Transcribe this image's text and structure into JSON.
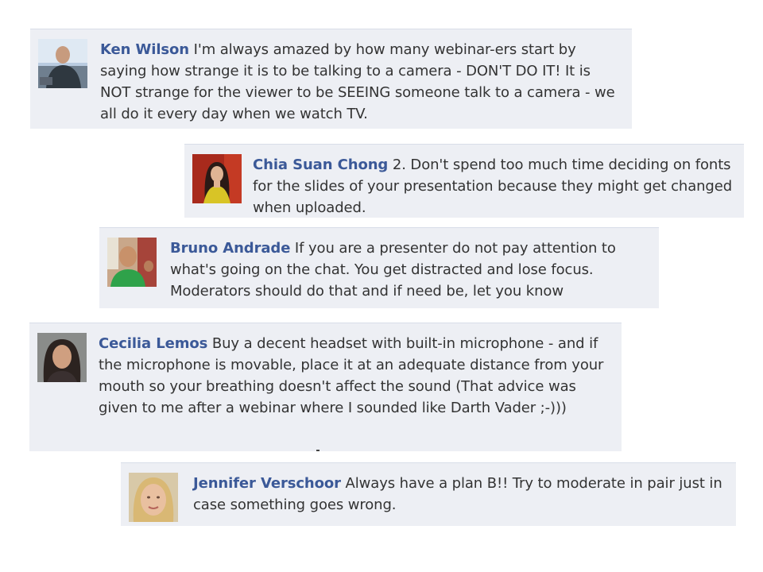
{
  "comments": [
    {
      "author": "Ken Wilson",
      "text": " I'm always amazed by how many webinar-ers start by saying how strange it is to be talking to a camera - DON'T DO IT! It is NOT strange for the viewer to be SEEING someone talk to a camera - we all do it every day when we watch TV."
    },
    {
      "author": "Chia Suan Chong",
      "text": " 2. Don't spend too much time deciding on fonts for the slides of your presentation because they might get changed when uploaded."
    },
    {
      "author": "Bruno Andrade",
      "text": " If you are a presenter do not pay attention to what's going on the chat. You get distracted and lose focus. Moderators should do that and if need be, let you know"
    },
    {
      "author": "Cecilia Lemos",
      "text": " Buy a decent headset with built-in microphone - and if the microphone is movable, place it at an adequate distance from your mouth so your breathing doesn't affect the sound (That advice was given to me after a webinar where I sounded like Darth Vader ;-)))"
    },
    {
      "author": "Jennifer Verschoor",
      "text": " Always have a plan B!! Try to moderate in pair just in case something goes wrong."
    }
  ]
}
